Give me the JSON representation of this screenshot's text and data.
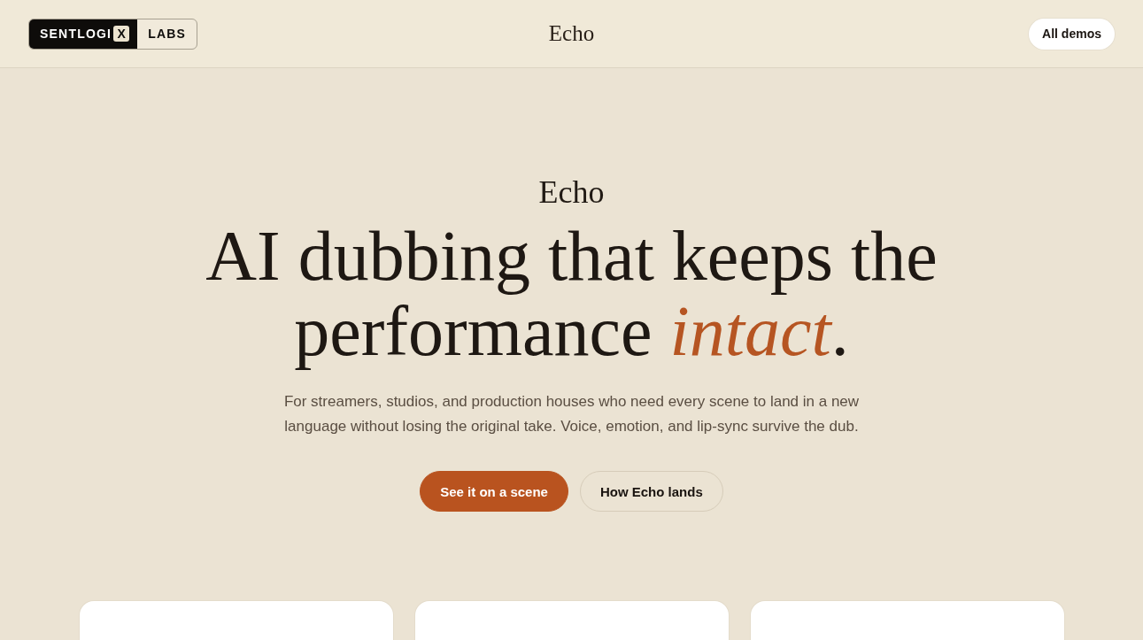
{
  "header": {
    "logo": {
      "wordmark": "SENTLOGI",
      "mark": "X",
      "suffix": "LABS"
    },
    "title": "Echo",
    "button": "All demos"
  },
  "hero": {
    "eyebrow": "Echo",
    "heading": "AI dubbing that keeps the performance *intact*.",
    "description": "For streamers, studios, and production houses who need every scene to land in a new language without losing the original take. Voice, emotion, and lip-sync survive the dub.",
    "buttons": [
      {
        "label": "See it on a scene",
        "kind": "primary"
      },
      {
        "label": "How Echo lands",
        "kind": "secondary"
      }
    ]
  }
}
